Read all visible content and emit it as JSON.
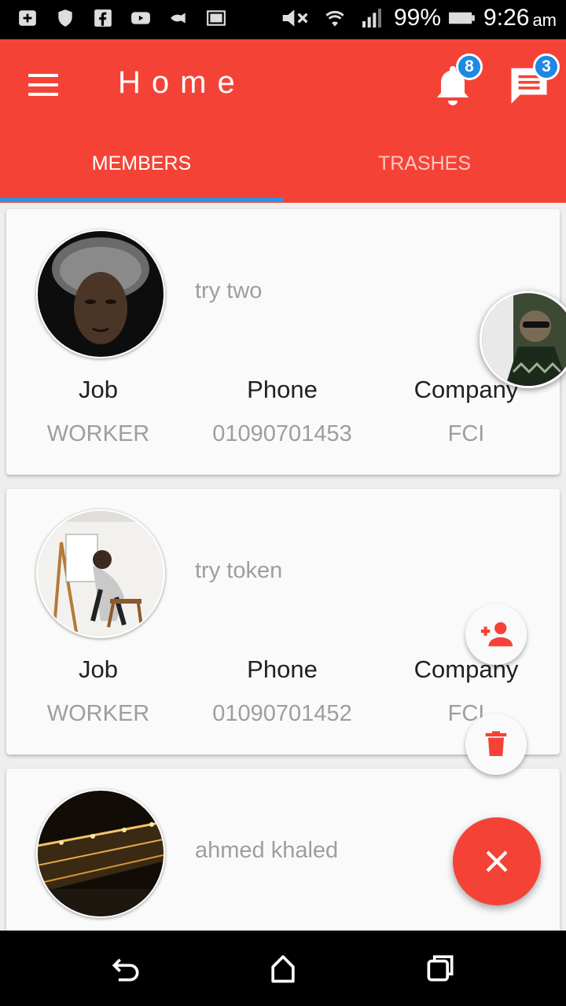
{
  "status_bar": {
    "battery": "99%",
    "time": "9:26",
    "ampm": "am",
    "icons": [
      "add-box-icon",
      "shield-icon",
      "facebook-icon",
      "youtube-icon",
      "fish-icon",
      "screenshot-icon",
      "mute-icon",
      "wifi-icon",
      "signal-icon",
      "battery-icon"
    ]
  },
  "app_bar": {
    "title": "Home",
    "notification_count": "8",
    "message_count": "3",
    "color": "#f44336"
  },
  "tabs": [
    {
      "label": "MEMBERS",
      "active": true
    },
    {
      "label": "TRASHES",
      "active": false
    }
  ],
  "members": [
    {
      "name": "try two",
      "job_label": "Job",
      "job": "WORKER",
      "phone_label": "Phone",
      "phone": "01090701453",
      "company_label": "Company",
      "company": "FCI"
    },
    {
      "name": "try token",
      "job_label": "Job",
      "job": "WORKER",
      "phone_label": "Phone",
      "phone": "01090701452",
      "company_label": "Company",
      "company": "FCI"
    },
    {
      "name": "ahmed khaled"
    }
  ],
  "fab": {
    "add_icon": "person-add-icon",
    "delete_icon": "delete-icon",
    "close_icon": "close-icon",
    "accent": "#f44336"
  }
}
